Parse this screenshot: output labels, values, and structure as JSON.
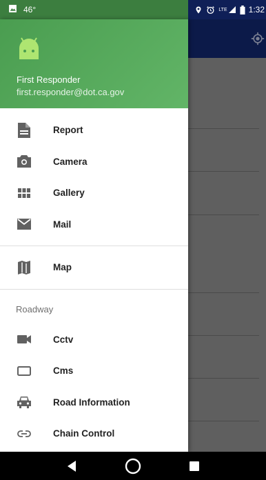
{
  "status_bar": {
    "temperature": "46°",
    "network": "LTE",
    "time": "1:32"
  },
  "user": {
    "name": "First Responder",
    "email": "first.responder@dot.ca.gov"
  },
  "menu_primary": [
    {
      "label": "Report",
      "icon": "document-icon"
    },
    {
      "label": "Camera",
      "icon": "camera-icon"
    },
    {
      "label": "Gallery",
      "icon": "grid-icon"
    },
    {
      "label": "Mail",
      "icon": "mail-icon"
    }
  ],
  "menu_secondary": [
    {
      "label": "Map",
      "icon": "map-icon"
    }
  ],
  "roadway": {
    "header": "Roadway",
    "items": [
      {
        "label": "Cctv",
        "icon": "videocam-icon"
      },
      {
        "label": "Cms",
        "icon": "display-icon"
      },
      {
        "label": "Road Information",
        "icon": "car-icon"
      },
      {
        "label": "Chain Control",
        "icon": "link-icon"
      }
    ]
  },
  "colors": {
    "header_green": "#4a9d50",
    "toolbar_navy": "#0c1a49",
    "icon_gray": "#616161"
  }
}
